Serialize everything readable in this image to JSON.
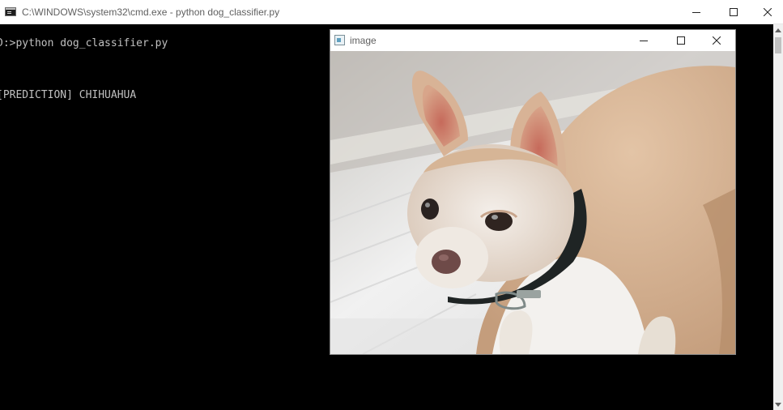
{
  "console_window": {
    "title": "C:\\WINDOWS\\system32\\cmd.exe - python  dog_classifier.py",
    "icon": "cmd-app-icon",
    "controls": {
      "minimize": "minimize-icon",
      "maximize": "maximize-icon",
      "close": "close-icon"
    }
  },
  "console": {
    "lines": [
      "D:>python dog_classifier.py",
      "[PREDICTION] CHIHUAHUA"
    ]
  },
  "image_window": {
    "title": "image",
    "icon": "image-app-icon",
    "controls": {
      "minimize": "minimize-icon",
      "maximize": "maximize-icon",
      "close": "close-icon"
    },
    "image_subject": "chihuahua photo"
  },
  "colors": {
    "console_bg": "#000000",
    "console_text": "#c0c0c0",
    "titlebar_bg": "#ffffff",
    "titlebar_text": "#5f5f5f"
  }
}
